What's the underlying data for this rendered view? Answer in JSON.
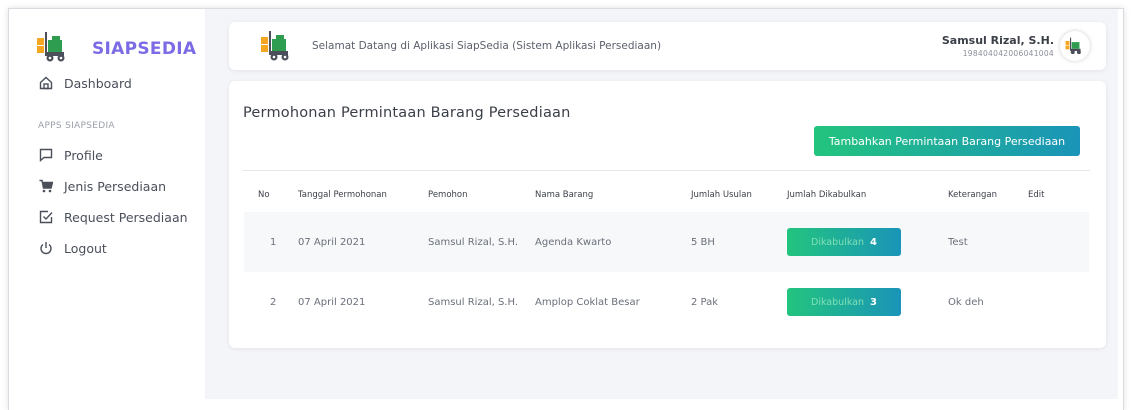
{
  "brand": {
    "name": "SIAPSEDIA",
    "logo_icon": "forklift-icon"
  },
  "sidebar": {
    "section_label": "APPS SIAPSEDIA",
    "items": [
      {
        "label": "Dashboard",
        "icon": "home-icon"
      },
      {
        "label": "Profile",
        "icon": "message-square-icon"
      },
      {
        "label": "Jenis Persediaan",
        "icon": "cart-icon"
      },
      {
        "label": "Request Persediaan",
        "icon": "check-square-icon"
      },
      {
        "label": "Logout",
        "icon": "power-icon"
      }
    ]
  },
  "header": {
    "welcome": "Selamat Datang di Aplikasi SiapSedia (Sistem Aplikasi Persediaan)",
    "user_name": "Samsul Rizal, S.H.",
    "user_nip": "198404042006041004"
  },
  "main": {
    "title": "Permohonan Permintaan Barang Persediaan",
    "add_button": "Tambahkan Permintaan Barang Persediaan",
    "table": {
      "columns": [
        "No",
        "Tanggal Permohonan",
        "Pemohon",
        "Nama Barang",
        "Jumlah Usulan",
        "Jumlah Dikabulkan",
        "Keterangan",
        "Edit"
      ],
      "rows": [
        {
          "no": "1",
          "tanggal": "07 April 2021",
          "pemohon": "Samsul Rizal, S.H.",
          "barang": "Agenda Kwarto",
          "usulan": "5 BH",
          "dikabulkan_label": "Dikabulkan",
          "dikabulkan_count": "4",
          "keterangan": "Test"
        },
        {
          "no": "2",
          "tanggal": "07 April 2021",
          "pemohon": "Samsul Rizal, S.H.",
          "barang": "Amplop Coklat Besar",
          "usulan": "2 Pak",
          "dikabulkan_label": "Dikabulkan",
          "dikabulkan_count": "3",
          "keterangan": "Ok deh"
        }
      ]
    }
  },
  "colors": {
    "brand": "#7b6ce6",
    "accent_start": "#23c47e",
    "accent_end": "#1a94b8"
  }
}
